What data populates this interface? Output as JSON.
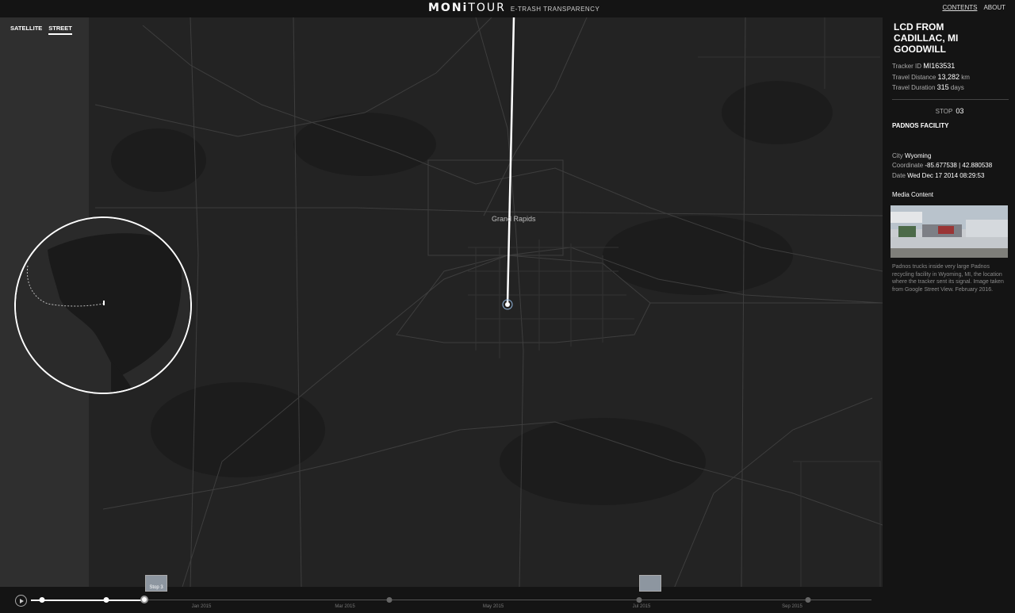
{
  "header": {
    "brand_left": "MONi",
    "brand_right": "TOUR",
    "brand_sub": "E-TRASH TRANSPARENCY",
    "nav": [
      "CONTENTS",
      "ABOUT"
    ]
  },
  "map": {
    "layers": [
      "SATELLITE",
      "STREET"
    ],
    "active_layer": "STREET",
    "city_label": "Grand Rapids"
  },
  "panel": {
    "title": "LCD FROM CADILLAC, MI GOODWILL",
    "tracker_id_label": "Tracker ID",
    "tracker_id": "MI163531",
    "distance_label": "Travel Distance",
    "distance": "13,282",
    "distance_unit": "km",
    "duration_label": "Travel Duration",
    "duration": "315",
    "duration_unit": "days",
    "stop_label": "STOP",
    "stop_number": "03",
    "stop_name": "PADNOS FACILITY",
    "city_label": "City",
    "city": "Wyoming",
    "coord_label": "Coordinate",
    "coord": "-85.677538 | 42.880538",
    "date_label": "Date",
    "date": "Wed Dec 17 2014 08:29:53",
    "media_label": "Media Content",
    "media_caption": "Padnos trucks inside very large Padnos recycling facility in Wyoming, MI, the location where the tracker sent its signal. Image taken from Google Street View. February 2016."
  },
  "timeline": {
    "months": [
      "Jan 2015",
      "Mar 2015",
      "May 2015",
      "Jul 2015",
      "Sep 2015"
    ],
    "thumb_label": "Stop 3"
  },
  "colors": {
    "map_bg": "#232323",
    "water": "#2f2f2f",
    "route": "#ffffff",
    "panel_bg": "#141414"
  }
}
